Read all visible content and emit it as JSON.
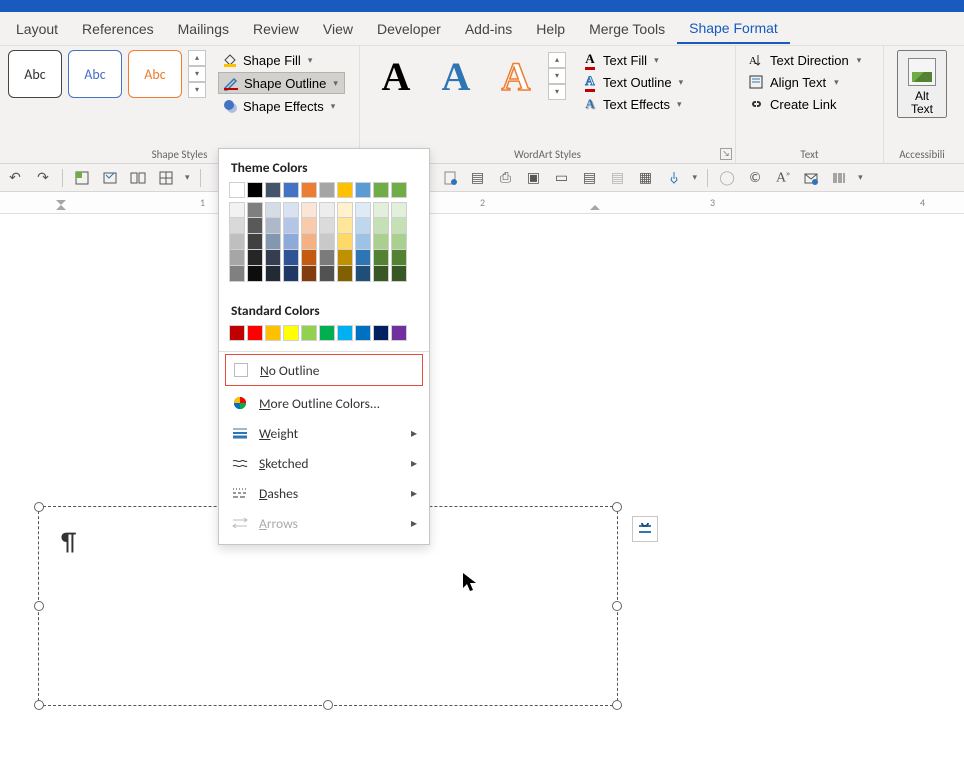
{
  "tabs": {
    "layout": "Layout",
    "references": "References",
    "mailings": "Mailings",
    "review": "Review",
    "view": "View",
    "developer": "Developer",
    "addins": "Add-ins",
    "help": "Help",
    "mergetools": "Merge Tools",
    "shapeformat": "Shape Format"
  },
  "ribbon": {
    "shape_styles_label": "Shape Styles",
    "style_thumb_text": "Abc",
    "shape_fill": "Shape Fill",
    "shape_outline": "Shape Outline",
    "shape_effects": "Shape Effects",
    "wordart_styles_label": "WordArt Styles",
    "wa_letter": "A",
    "text_fill": "Text Fill",
    "text_outline": "Text Outline",
    "text_effects": "Text Effects",
    "text_label": "Text",
    "text_direction": "Text Direction",
    "align_text": "Align Text",
    "create_link": "Create Link",
    "accessibility_label": "Accessibili",
    "alt_text_line1": "Alt",
    "alt_text_line2": "Text"
  },
  "dropdown": {
    "theme_colors": "Theme Colors",
    "standard_colors": "Standard Colors",
    "no_outline": "o Outline",
    "no_outline_accel": "N",
    "more_colors": "ore Outline Colors...",
    "more_colors_accel": "M",
    "weight": "eight",
    "weight_accel": "W",
    "sketched": "ketched",
    "sketched_accel": "S",
    "dashes": "ashes",
    "dashes_accel": "D",
    "arrows": "rrows",
    "arrows_accel": "A"
  },
  "ruler": {
    "marks": [
      "1",
      "2",
      "3",
      "4"
    ]
  },
  "doc": {
    "pilcrow": "¶"
  },
  "theme_swatches_row": [
    "#ffffff",
    "#000000",
    "#44546a",
    "#4472c4",
    "#ed7d31",
    "#a5a5a5",
    "#ffc000",
    "#5b9bd5",
    "#70ad47",
    "#70ad47"
  ],
  "theme_shade_columns": [
    [
      "#f2f2f2",
      "#d9d9d9",
      "#bfbfbf",
      "#a6a6a6",
      "#808080"
    ],
    [
      "#7f7f7f",
      "#595959",
      "#404040",
      "#262626",
      "#0d0d0d"
    ],
    [
      "#d6dce5",
      "#adb9ca",
      "#8497b0",
      "#333f50",
      "#222a35"
    ],
    [
      "#d9e2f3",
      "#b4c6e7",
      "#8eaadb",
      "#2f5496",
      "#1f3864"
    ],
    [
      "#fbe5d6",
      "#f7cbac",
      "#f4b183",
      "#c55a11",
      "#833c0c"
    ],
    [
      "#ededed",
      "#dbdbdb",
      "#c9c9c9",
      "#7b7b7b",
      "#525252"
    ],
    [
      "#fff2cc",
      "#ffe699",
      "#ffd966",
      "#bf9000",
      "#806000"
    ],
    [
      "#deebf7",
      "#bdd7ee",
      "#9cc3e6",
      "#2e75b6",
      "#1f4e79"
    ],
    [
      "#e2efda",
      "#c5e0b4",
      "#a9d08e",
      "#548235",
      "#385723"
    ],
    [
      "#e2efda",
      "#c5e0b4",
      "#a9d08e",
      "#548235",
      "#385723"
    ]
  ],
  "standard_swatches": [
    "#c00000",
    "#ff0000",
    "#ffc000",
    "#ffff00",
    "#92d050",
    "#00b050",
    "#00b0f0",
    "#0070c0",
    "#002060",
    "#7030a0"
  ]
}
